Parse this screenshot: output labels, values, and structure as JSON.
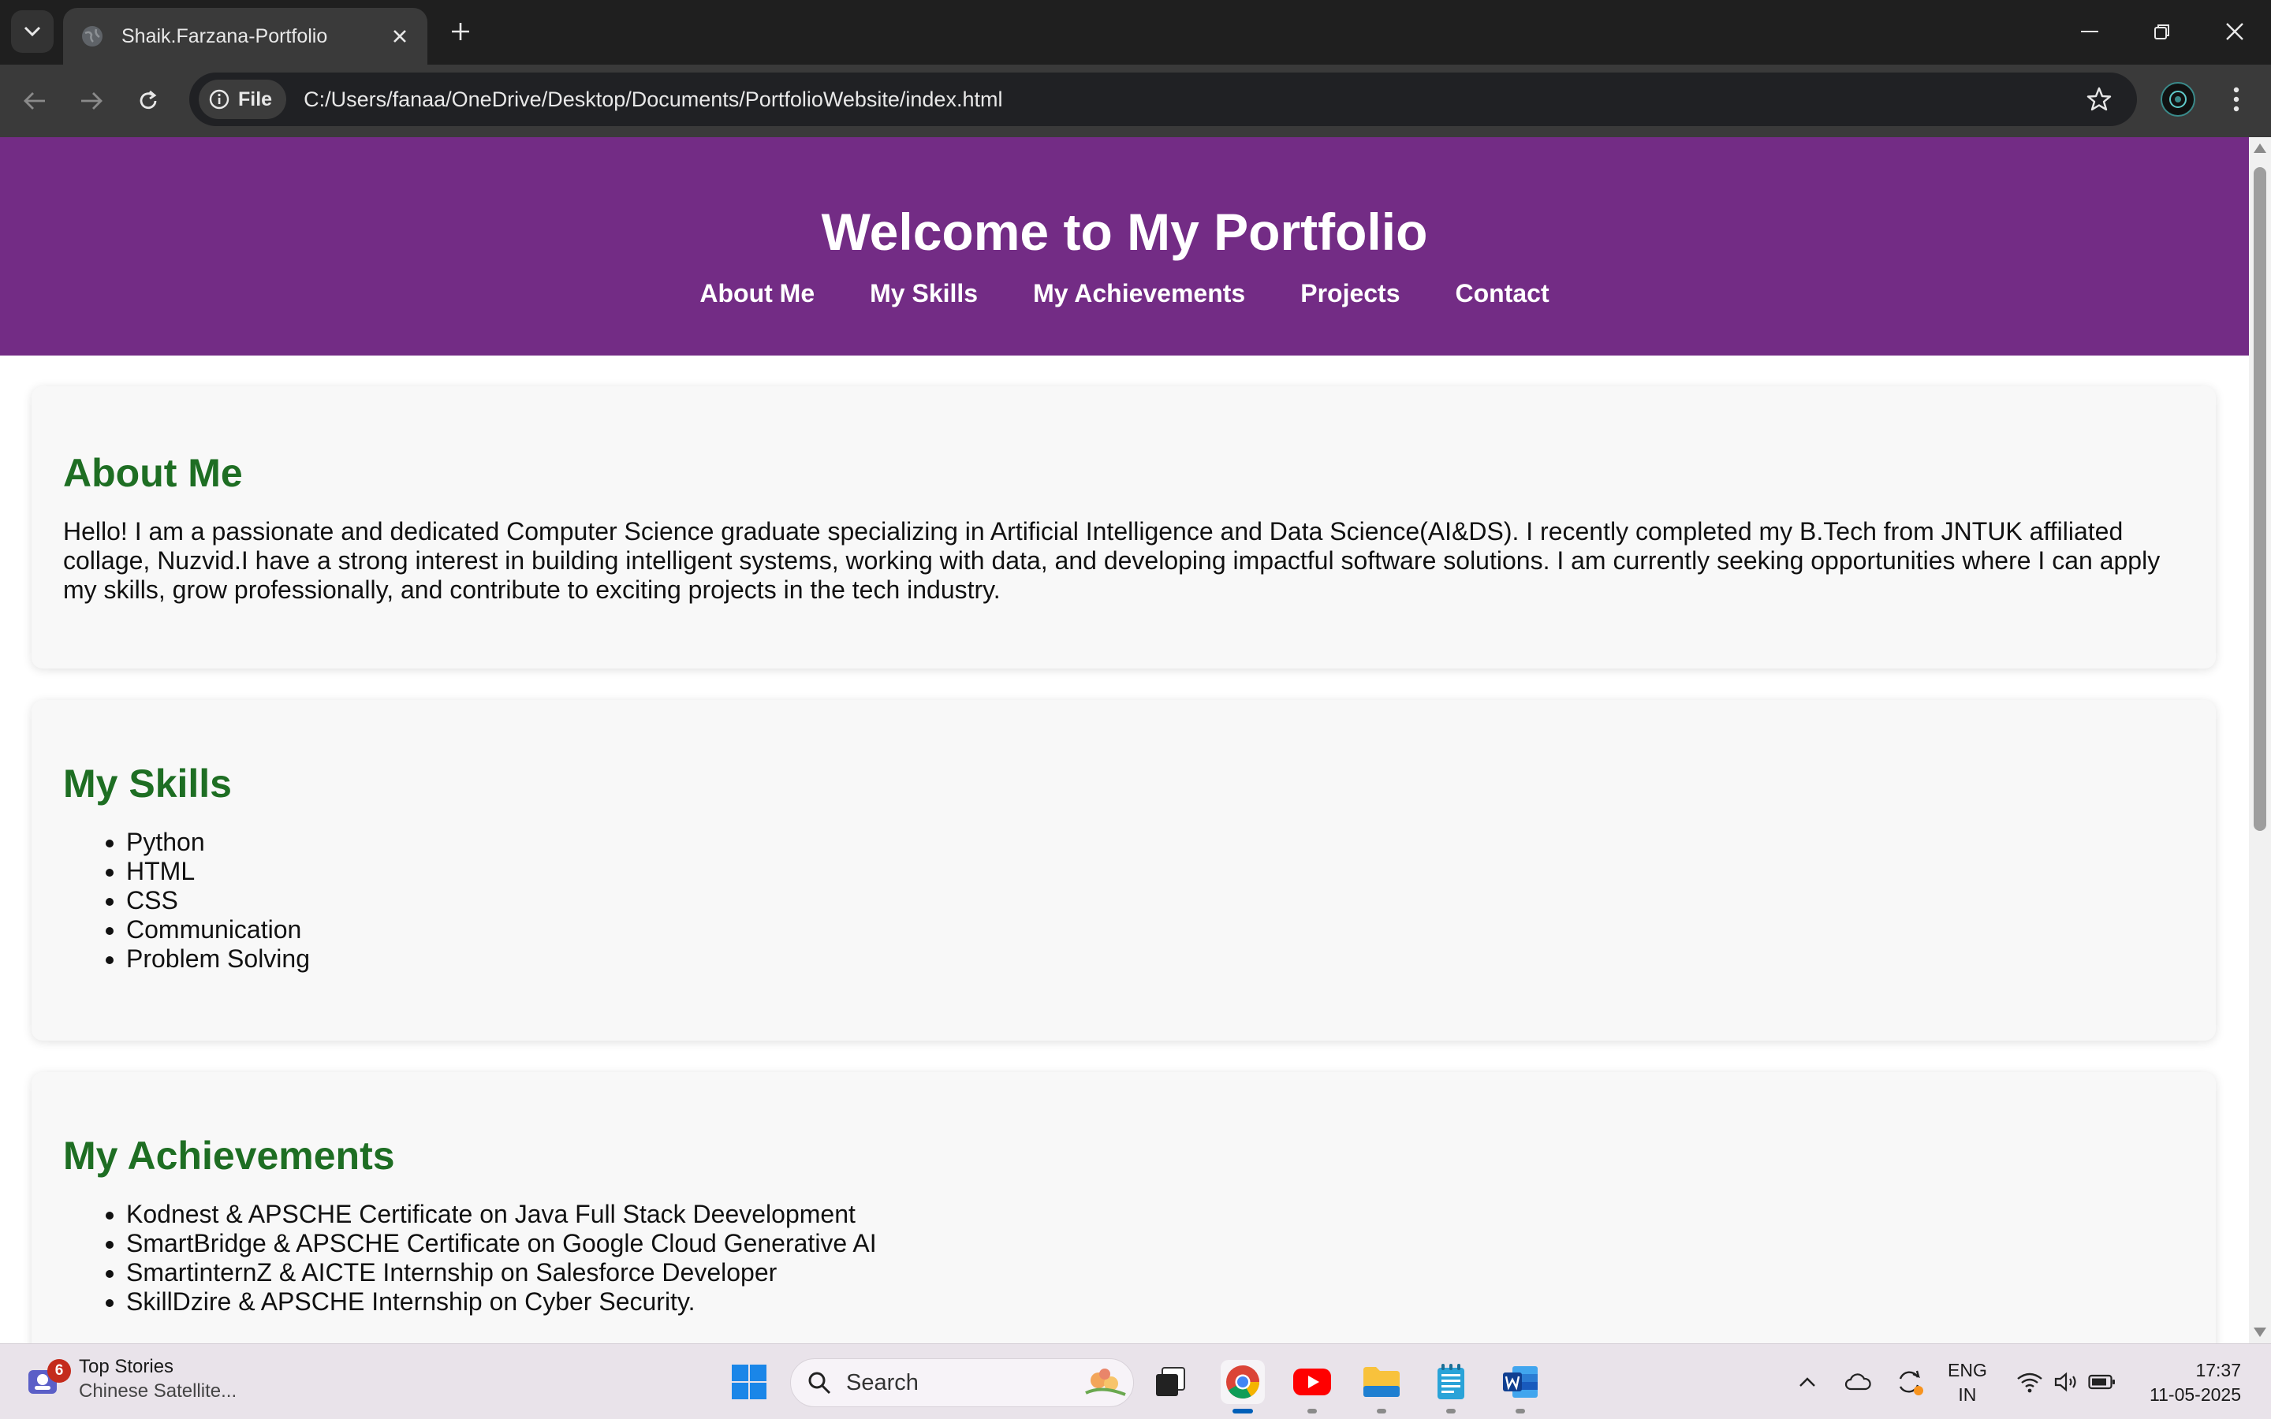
{
  "browser": {
    "tab_title": "Shaik.Farzana-Portfolio",
    "chip_label": "File",
    "url": "C:/Users/fanaa/OneDrive/Desktop/Documents/PortfolioWebsite/index.html"
  },
  "site": {
    "title": "Welcome to My Portfolio",
    "nav": [
      "About Me",
      "My Skills",
      "My Achievements",
      "Projects",
      "Contact"
    ],
    "colors": {
      "header": "#732c85",
      "heading": "#1e6e23",
      "card": "#f8f8f8"
    }
  },
  "about": {
    "heading": "About Me",
    "text": "Hello! I am a passionate and dedicated Computer Science graduate specializing in Artificial Intelligence and Data Science(AI&DS). I recently completed my B.Tech from JNTUK affiliated collage, Nuzvid.I have a strong interest in building intelligent systems, working with data, and developing impactful software solutions. I am currently seeking opportunities where I can apply my skills, grow professionally, and contribute to exciting projects in the tech industry."
  },
  "skills": {
    "heading": "My Skills",
    "items": [
      "Python",
      "HTML",
      "CSS",
      "Communication",
      "Problem Solving"
    ]
  },
  "achievements": {
    "heading": "My Achievements",
    "items": [
      "Kodnest & APSCHE Certificate on Java Full Stack Deevelopment",
      "SmartBridge & APSCHE Certificate on Google Cloud Generative AI",
      "SmartinternZ & AICTE Internship on Salesforce Developer",
      "SkillDzire & APSCHE Internship on Cyber Security."
    ]
  },
  "taskbar": {
    "news_badge": "6",
    "news_title": "Top Stories",
    "news_subtitle": "Chinese Satellite...",
    "search_label": "Search",
    "lang_line1": "ENG",
    "lang_line2": "IN",
    "time": "17:37",
    "date": "11-05-2025"
  }
}
